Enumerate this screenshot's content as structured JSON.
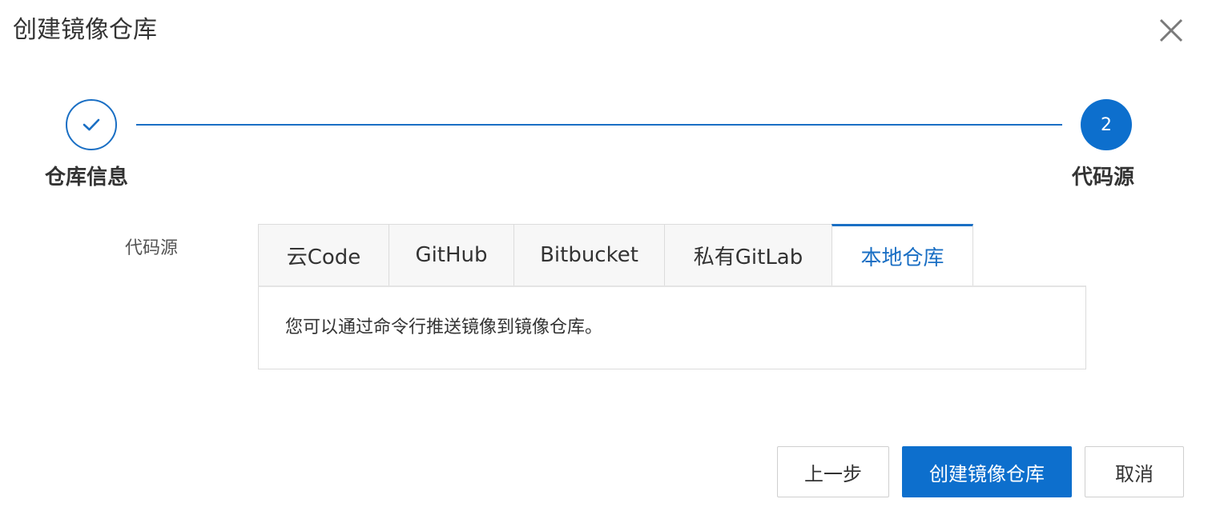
{
  "dialog": {
    "title": "创建镜像仓库",
    "close_icon": "close-icon"
  },
  "steps": [
    {
      "label": "仓库信息",
      "status": "done",
      "icon": "check-icon"
    },
    {
      "label": "代码源",
      "status": "active",
      "number": "2"
    }
  ],
  "form": {
    "field_label": "代码源",
    "tabs": [
      {
        "label": "云Code",
        "active": false
      },
      {
        "label": "GitHub",
        "active": false
      },
      {
        "label": "Bitbucket",
        "active": false
      },
      {
        "label": "私有GitLab",
        "active": false
      },
      {
        "label": "本地仓库",
        "active": true
      }
    ],
    "panel_text": "您可以通过命令行推送镜像到镜像仓库。"
  },
  "footer": {
    "prev_label": "上一步",
    "create_label": "创建镜像仓库",
    "cancel_label": "取消"
  },
  "colors": {
    "accent": "#0d6fcd",
    "step_line": "#1a6fc4",
    "border": "#dcdcdc"
  }
}
